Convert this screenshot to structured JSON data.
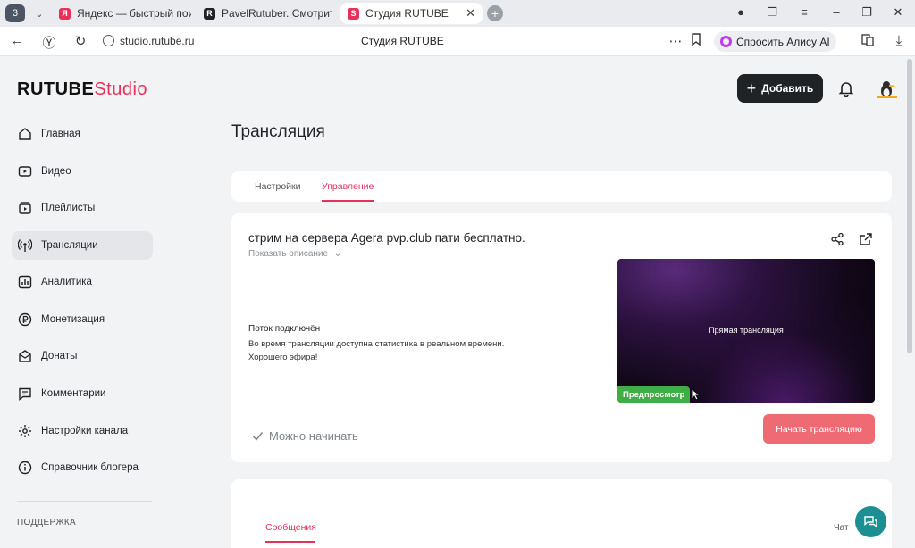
{
  "browser": {
    "tab_count": "3",
    "tabs": [
      {
        "title": "Яндекс — быстрый поиск",
        "favicon": "yandex-icon",
        "color": "#e8305a"
      },
      {
        "title": "PavelRutuber. Смотрите в",
        "favicon": "rutube-icon",
        "color": "#1f2326"
      },
      {
        "title": "Студия RUTUBE",
        "favicon": "rutube-studio-icon",
        "color": "#e8305a"
      }
    ],
    "url": "studio.rutube.ru",
    "page_title": "Студия RUTUBE",
    "alice_label": "Спросить Алису AI"
  },
  "header": {
    "logo_main": "RUTUBE",
    "logo_studio": "Studio",
    "add_label": "Добавить"
  },
  "sidebar": {
    "items": [
      {
        "label": "Главная",
        "icon": "home-icon"
      },
      {
        "label": "Видео",
        "icon": "video-icon"
      },
      {
        "label": "Плейлисты",
        "icon": "playlist-icon"
      },
      {
        "label": "Трансляции",
        "icon": "broadcast-icon",
        "active": true
      },
      {
        "label": "Аналитика",
        "icon": "analytics-icon"
      },
      {
        "label": "Монетизация",
        "icon": "ruble-icon"
      },
      {
        "label": "Донаты",
        "icon": "donate-icon"
      },
      {
        "label": "Комментарии",
        "icon": "comment-icon"
      },
      {
        "label": "Настройки канала",
        "icon": "gear-icon"
      },
      {
        "label": "Справочник блогера",
        "icon": "info-icon"
      }
    ],
    "support_label": "ПОДДЕРЖКА"
  },
  "main": {
    "title": "Трансляция",
    "tabs": [
      {
        "label": "Настройки"
      },
      {
        "label": "Управление",
        "active": true
      }
    ],
    "stream": {
      "title": "стрим на сервера Agera pvp.club пати бесплатно.",
      "show_description": "Показать описание",
      "status_title": "Поток подключён",
      "status_line1": "Во время трансляции доступна статистика в реальном времени.",
      "status_line2": "Хорошего эфира!",
      "preview_label": "Прямая трансляция",
      "preview_badge": "Предпросмотр",
      "ready_label": "Можно начинать",
      "start_button": "Начать трансляцию"
    },
    "chat": {
      "messages_tab": "Сообщения",
      "chat_label": "Чат"
    }
  },
  "colors": {
    "accent": "#e8305a",
    "start_button": "#ef6b73",
    "preview_badge": "#3fae46",
    "help_fab": "#1b8f92"
  }
}
